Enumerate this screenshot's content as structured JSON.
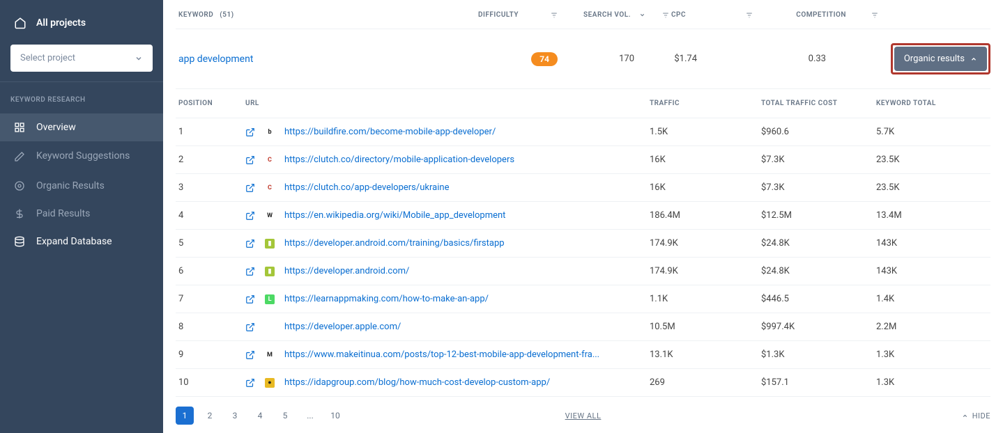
{
  "sidebar": {
    "all_projects": "All projects",
    "select_project": "Select project",
    "section_title": "KEYWORD RESEARCH",
    "items": [
      {
        "label": "Overview"
      },
      {
        "label": "Keyword Suggestions"
      },
      {
        "label": "Organic Results"
      },
      {
        "label": "Paid Results"
      },
      {
        "label": "Expand Database"
      }
    ]
  },
  "table_header": {
    "keyword": "KEYWORD",
    "keyword_count": "(51)",
    "difficulty": "DIFFICULTY",
    "search_vol": "SEARCH VOL.",
    "cpc": "CPC",
    "competition": "COMPETITION"
  },
  "keyword_row": {
    "keyword": "app development",
    "difficulty": "74",
    "search_vol": "170",
    "cpc": "$1.74",
    "competition": "0.33",
    "button_label": "Organic results"
  },
  "results_header": {
    "position": "POSITION",
    "url": "URL",
    "traffic": "TRAFFIC",
    "total_cost": "TOTAL TRAFFIC COST",
    "keyword_total": "KEYWORD TOTAL"
  },
  "results": [
    {
      "pos": "1",
      "favicon_bg": "#ffffff",
      "favicon_color": "#222",
      "favicon_text": "b",
      "url": "https://buildfire.com/become-mobile-app-developer/",
      "traffic": "1.5K",
      "cost": "$960.6",
      "total": "5.7K"
    },
    {
      "pos": "2",
      "favicon_bg": "#ffffff",
      "favicon_color": "#c0392b",
      "favicon_text": "C",
      "url": "https://clutch.co/directory/mobile-application-developers",
      "traffic": "16K",
      "cost": "$7.3K",
      "total": "23.5K"
    },
    {
      "pos": "3",
      "favicon_bg": "#ffffff",
      "favicon_color": "#c0392b",
      "favicon_text": "C",
      "url": "https://clutch.co/app-developers/ukraine",
      "traffic": "16K",
      "cost": "$7.3K",
      "total": "23.5K"
    },
    {
      "pos": "4",
      "favicon_bg": "#ffffff",
      "favicon_color": "#222",
      "favicon_text": "W",
      "url": "https://en.wikipedia.org/wiki/Mobile_app_development",
      "traffic": "186.4M",
      "cost": "$12.5M",
      "total": "13.4M"
    },
    {
      "pos": "5",
      "favicon_bg": "#a4c639",
      "favicon_color": "#fff",
      "favicon_text": "▮",
      "url": "https://developer.android.com/training/basics/firstapp",
      "traffic": "174.9K",
      "cost": "$24.8K",
      "total": "143K"
    },
    {
      "pos": "6",
      "favicon_bg": "#a4c639",
      "favicon_color": "#fff",
      "favicon_text": "▮",
      "url": "https://developer.android.com/",
      "traffic": "174.9K",
      "cost": "$24.8K",
      "total": "143K"
    },
    {
      "pos": "7",
      "favicon_bg": "#4cd964",
      "favicon_color": "#fff",
      "favicon_text": "L",
      "url": "https://learnappmaking.com/how-to-make-an-app/",
      "traffic": "1.1K",
      "cost": "$446.5",
      "total": "1.4K"
    },
    {
      "pos": "8",
      "favicon_bg": "#ffffff",
      "favicon_color": "#555",
      "favicon_text": "",
      "url": "https://developer.apple.com/",
      "traffic": "10.5M",
      "cost": "$997.4K",
      "total": "2.2M"
    },
    {
      "pos": "9",
      "favicon_bg": "#ffffff",
      "favicon_color": "#222",
      "favicon_text": "M",
      "url": "https://www.makeitinua.com/posts/top-12-best-mobile-app-development-fra...",
      "traffic": "13.1K",
      "cost": "$1.3K",
      "total": "1.3K"
    },
    {
      "pos": "10",
      "favicon_bg": "#e8b923",
      "favicon_color": "#222",
      "favicon_text": "●",
      "url": "https://idapgroup.com/blog/how-much-cost-develop-custom-app/",
      "traffic": "269",
      "cost": "$157.1",
      "total": "1.3K"
    }
  ],
  "footer": {
    "pages": [
      "1",
      "2",
      "3",
      "4",
      "5",
      "...",
      "10"
    ],
    "view_all": "VIEW ALL",
    "hide": "HIDE"
  }
}
